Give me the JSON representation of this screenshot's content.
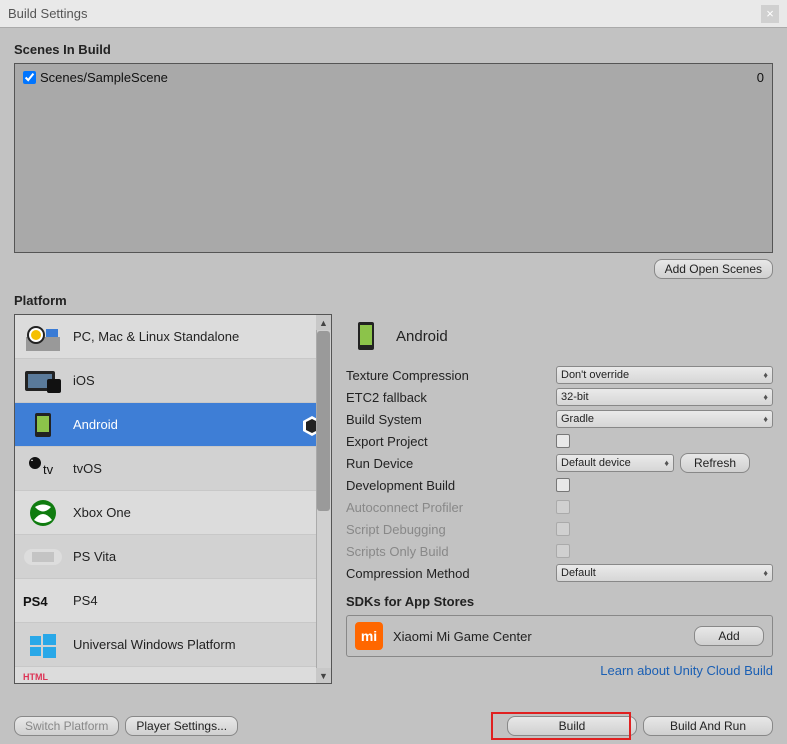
{
  "window": {
    "title": "Build Settings",
    "close": "×"
  },
  "scenes": {
    "label": "Scenes In Build",
    "items": [
      {
        "name": "Scenes/SampleScene",
        "index": "0",
        "checked": true
      }
    ],
    "add_button": "Add Open Scenes"
  },
  "platform": {
    "label": "Platform",
    "items": [
      {
        "name": "PC, Mac & Linux Standalone"
      },
      {
        "name": "iOS"
      },
      {
        "name": "Android",
        "selected": true
      },
      {
        "name": "tvOS"
      },
      {
        "name": "Xbox One"
      },
      {
        "name": "PS Vita"
      },
      {
        "name": "PS4"
      },
      {
        "name": "Universal Windows Platform"
      },
      {
        "name": "HTML"
      }
    ]
  },
  "selected_platform": {
    "name": "Android"
  },
  "settings": {
    "texture_compression": {
      "label": "Texture Compression",
      "value": "Don't override"
    },
    "etc2": {
      "label": "ETC2 fallback",
      "value": "32-bit"
    },
    "build_system": {
      "label": "Build System",
      "value": "Gradle"
    },
    "export_project": {
      "label": "Export Project"
    },
    "run_device": {
      "label": "Run Device",
      "value": "Default device",
      "refresh": "Refresh"
    },
    "dev_build": {
      "label": "Development Build"
    },
    "autoconnect": {
      "label": "Autoconnect Profiler"
    },
    "script_debug": {
      "label": "Script Debugging"
    },
    "scripts_only": {
      "label": "Scripts Only Build"
    },
    "compression": {
      "label": "Compression Method",
      "value": "Default"
    }
  },
  "sdk": {
    "label": "SDKs for App Stores",
    "xiaomi": "Xiaomi Mi Game Center",
    "add": "Add"
  },
  "cloud_link": "Learn about Unity Cloud Build",
  "footer": {
    "switch": "Switch Platform",
    "player": "Player Settings...",
    "build": "Build",
    "build_run": "Build And Run"
  }
}
